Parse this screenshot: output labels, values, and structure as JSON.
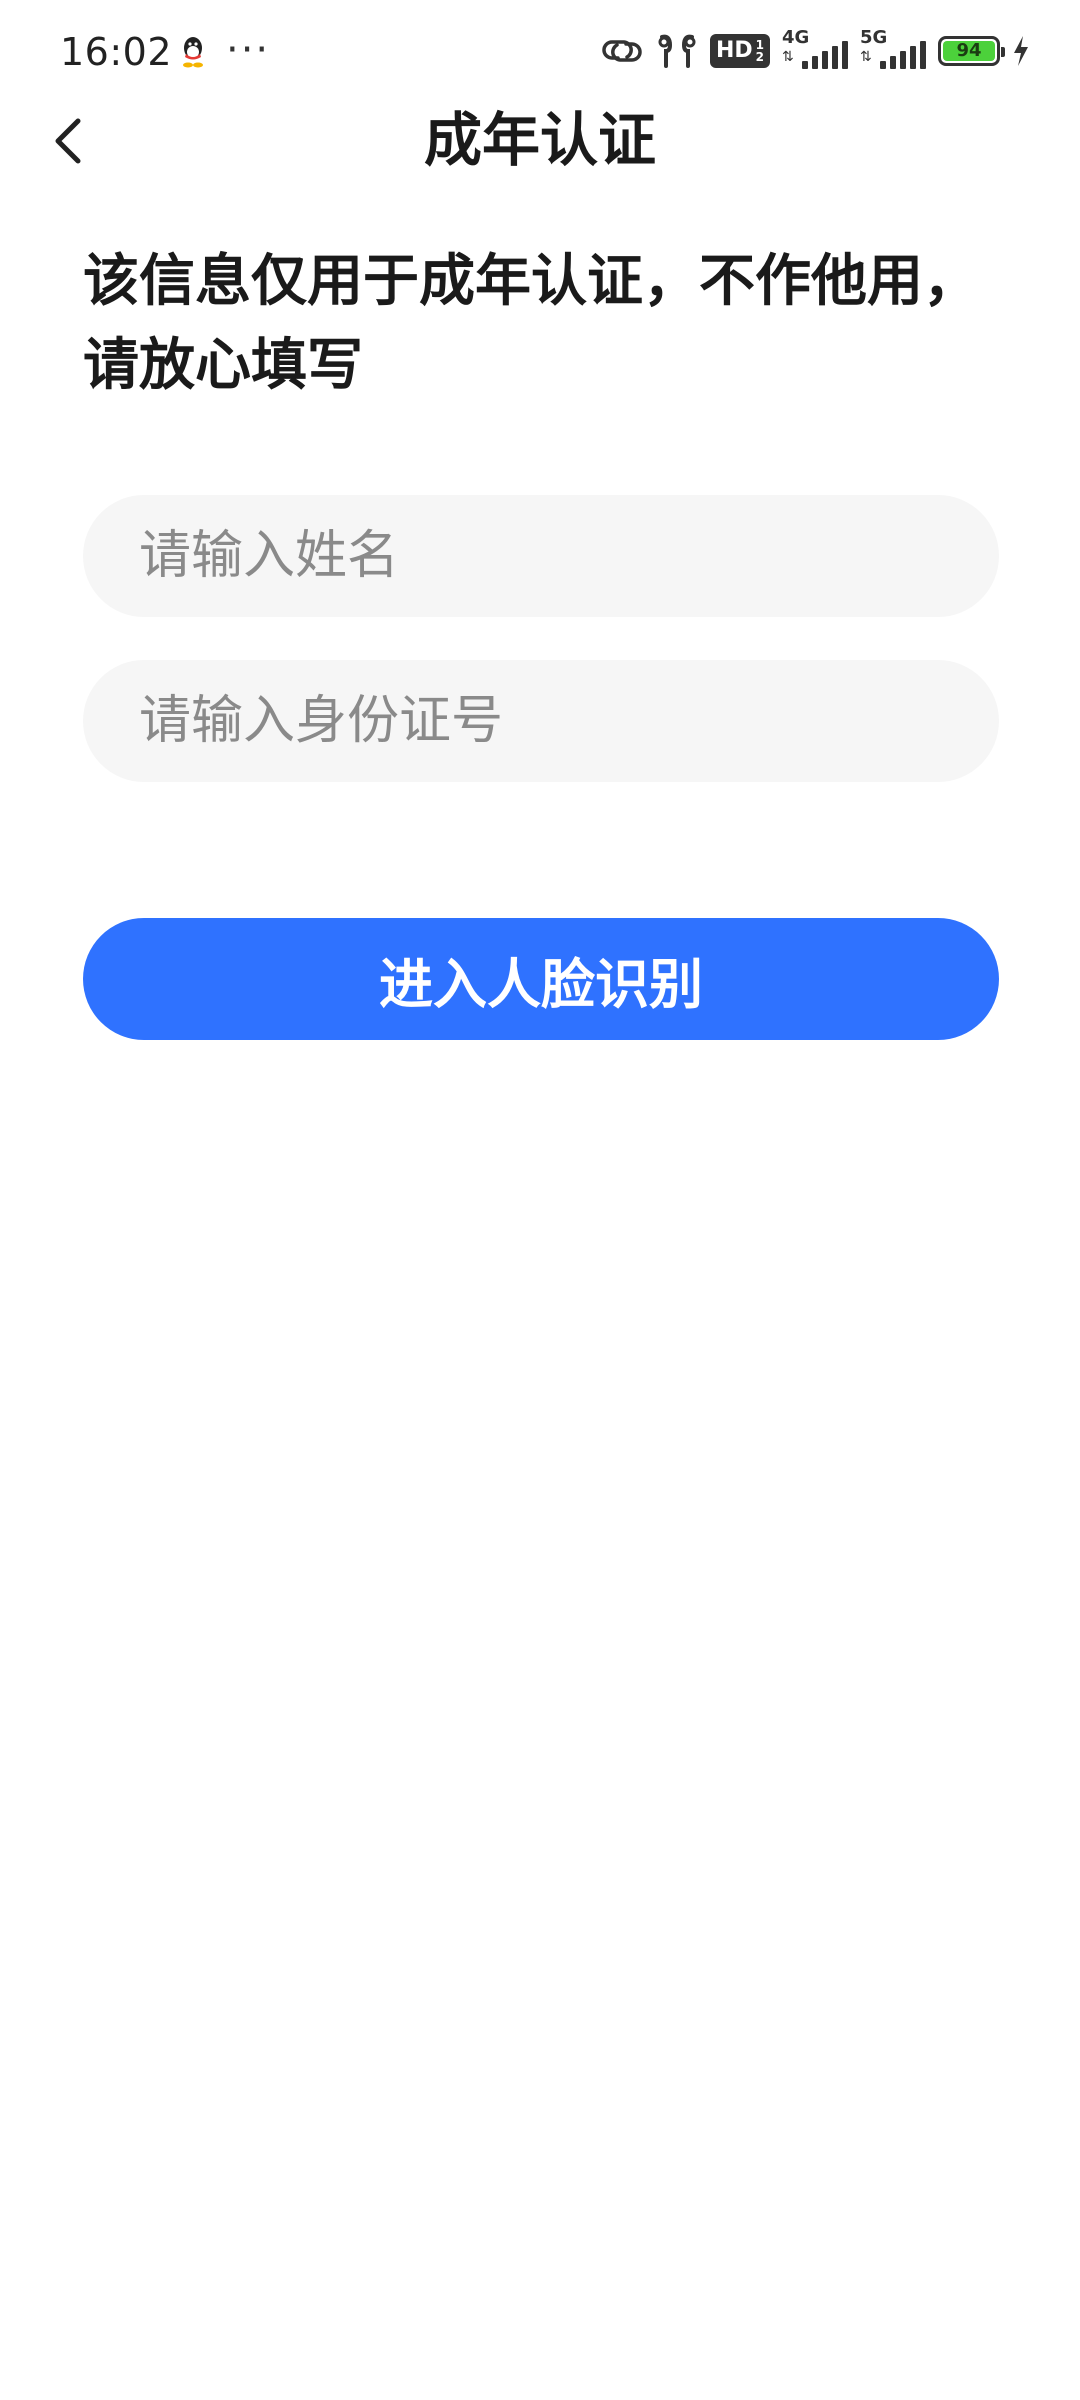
{
  "status_bar": {
    "time": "16:02",
    "more": "···",
    "hd_label": "HD",
    "hd_top": "1",
    "hd_bottom": "2",
    "network_1": "4G",
    "network_2": "5G",
    "battery_level": "94",
    "battery_color": "#4cd13b",
    "icons": [
      "qq-icon",
      "link-icon",
      "earbuds-icon",
      "hd-badge",
      "signal-4g-icon",
      "signal-5g-icon",
      "battery-icon",
      "charging-icon"
    ]
  },
  "header": {
    "title": "成年认证",
    "back_icon": "chevron-left-icon"
  },
  "notice": {
    "text": "该信息仅用于成年认证，不作他用，请放心填写"
  },
  "form": {
    "name_placeholder": "请输入姓名",
    "name_value": "",
    "id_placeholder": "请输入身份证号",
    "id_value": ""
  },
  "actions": {
    "submit_label": "进入人脸识别",
    "accent_color": "#2f72ff"
  }
}
